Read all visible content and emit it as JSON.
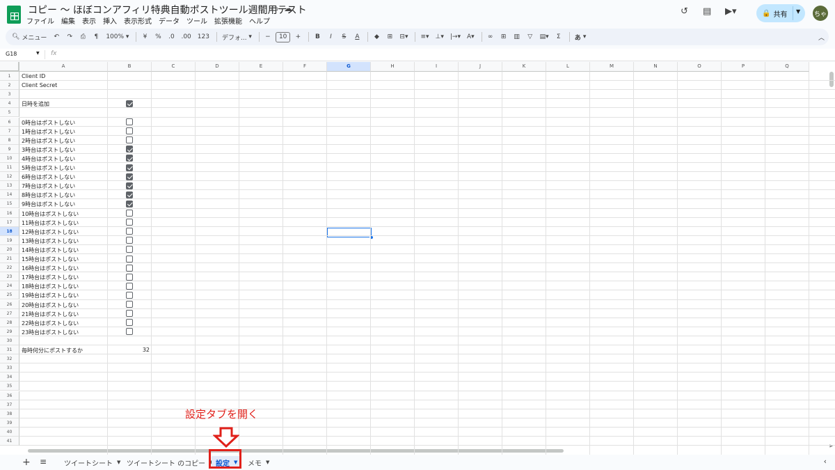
{
  "header": {
    "title": "コピー ～ ほぼコンアフィリ特典自動ポストツール週間用テスト",
    "menu": [
      "ファイル",
      "編集",
      "表示",
      "挿入",
      "表示形式",
      "データ",
      "ツール",
      "拡張機能",
      "ヘルプ"
    ],
    "share_label": "共有",
    "avatar_text": "ちゃ"
  },
  "toolbar": {
    "menu_search": "メニュー",
    "zoom": "100%",
    "currency": "¥",
    "percent": "%",
    "dec_decrease": ".0",
    "dec_increase": ".00",
    "number_format": "123",
    "font": "デフォ...",
    "font_size": "10",
    "input_tools": "あ"
  },
  "formula_bar": {
    "name_box": "G18",
    "fx": "fx",
    "value": ""
  },
  "sheet": {
    "columns": [
      "A",
      "B",
      "C",
      "D",
      "E",
      "F",
      "G",
      "H",
      "I",
      "J",
      "K",
      "L",
      "M",
      "N",
      "O",
      "P",
      "Q"
    ],
    "selected_column": "G",
    "selected_row": 18,
    "row_numbers": [
      "1",
      "2",
      "3",
      "4",
      "5",
      "6",
      "7",
      "8",
      "9",
      "10",
      "11",
      "12",
      "13",
      "14",
      "15",
      "16",
      "17",
      "18",
      "19",
      "20",
      "21",
      "22",
      "23",
      "24",
      "25",
      "26",
      "27",
      "28",
      "29",
      "30",
      "31",
      "32",
      "33",
      "34",
      "35",
      "36",
      "37",
      "38",
      "39",
      "40",
      "41"
    ],
    "col_a": [
      "Client ID",
      "Client Secret",
      "",
      "日時を追加",
      "",
      "0時台はポストしない",
      "1時台はポストしない",
      "2時台はポストしない",
      "3時台はポストしない",
      "4時台はポストしない",
      "5時台はポストしない",
      "6時台はポストしない",
      "7時台はポストしない",
      "8時台はポストしない",
      "9時台はポストしない",
      "10時台はポストしない",
      "11時台はポストしない",
      "12時台はポストしない",
      "13時台はポストしない",
      "14時台はポストしない",
      "15時台はポストしない",
      "16時台はポストしない",
      "17時台はポストしない",
      "18時台はポストしない",
      "19時台はポストしない",
      "20時台はポストしない",
      "21時台はポストしない",
      "22時台はポストしない",
      "23時台はポストしない",
      "",
      "毎時何分にポストするか"
    ],
    "checkboxes": [
      {
        "row": 4,
        "checked": true
      },
      {
        "row": 6,
        "checked": false
      },
      {
        "row": 7,
        "checked": false
      },
      {
        "row": 8,
        "checked": false
      },
      {
        "row": 9,
        "checked": true
      },
      {
        "row": 10,
        "checked": true
      },
      {
        "row": 11,
        "checked": true
      },
      {
        "row": 12,
        "checked": true
      },
      {
        "row": 13,
        "checked": true
      },
      {
        "row": 14,
        "checked": true
      },
      {
        "row": 15,
        "checked": true
      },
      {
        "row": 16,
        "checked": false
      },
      {
        "row": 17,
        "checked": false
      },
      {
        "row": 18,
        "checked": false
      },
      {
        "row": 19,
        "checked": false
      },
      {
        "row": 20,
        "checked": false
      },
      {
        "row": 21,
        "checked": false
      },
      {
        "row": 22,
        "checked": false
      },
      {
        "row": 23,
        "checked": false
      },
      {
        "row": 24,
        "checked": false
      },
      {
        "row": 25,
        "checked": false
      },
      {
        "row": 26,
        "checked": false
      },
      {
        "row": 27,
        "checked": false
      },
      {
        "row": 28,
        "checked": false
      },
      {
        "row": 29,
        "checked": false
      }
    ],
    "b31_value": "32"
  },
  "annotation": {
    "text": "設定タブを開く",
    "color": "#e0201a"
  },
  "tabs": [
    {
      "label": "ツイートシート",
      "active": false
    },
    {
      "label": "ツイートシート のコピー",
      "active": false
    },
    {
      "label": "設定",
      "active": true
    },
    {
      "label": "メモ",
      "active": false
    }
  ]
}
